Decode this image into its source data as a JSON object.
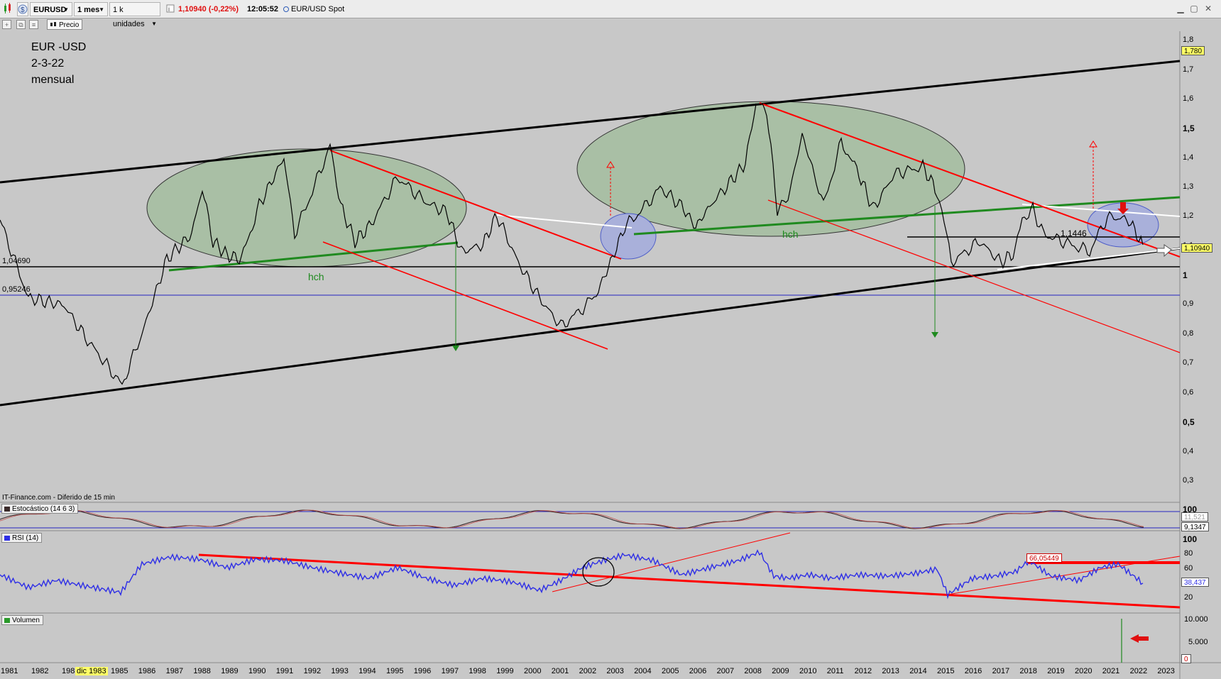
{
  "toolbar": {
    "symbol": "EURUSD",
    "timeframe": "1 mes",
    "units": "1 k unidades",
    "last_price": "1,10940 (-0,22%)",
    "time": "12:05:52",
    "instrument_name": "EUR/USD Spot"
  },
  "subbar": {
    "precio_label": "Precio"
  },
  "annotation": {
    "line1": "EUR -USD",
    "line2": "2-3-22",
    "line3": "mensual"
  },
  "price_panel": {
    "y_labels": [
      "1,8",
      "1,7",
      "1,6",
      "1,5",
      "1,4",
      "1,3",
      "1,2",
      "1,1",
      "1",
      "0,9",
      "0,8",
      "0,7",
      "0,6",
      "0,5",
      "0,4",
      "0,3"
    ],
    "current_price_box": "1,10940",
    "top_price_box": "1,780",
    "level_left_1": "1,04690",
    "level_left_2": "0,95246",
    "level_mid": "1,1446",
    "hch_labels": [
      "hch",
      "hch"
    ],
    "source_note": "IT-Finance.com - Diferido de 15 min"
  },
  "stochastic": {
    "title": "Estocástico (14 6 3)",
    "y_top": "100",
    "value_box": "9,1347",
    "hidden_box": "11,521"
  },
  "rsi": {
    "title": "RSI (14)",
    "y_labels": [
      "100",
      "80",
      "60",
      "40",
      "20"
    ],
    "value_box": "38,437",
    "level_box": "66,05449"
  },
  "volume": {
    "title": "Volumen",
    "y_labels": [
      "10.000",
      "5.000",
      "0"
    ]
  },
  "x_axis": {
    "labels": [
      "1981",
      "1982",
      "1983",
      "dic 1983",
      "1985",
      "1986",
      "1987",
      "1988",
      "1989",
      "1990",
      "1991",
      "1992",
      "1993",
      "1994",
      "1995",
      "1996",
      "1997",
      "1998",
      "1999",
      "2000",
      "2001",
      "2002",
      "2003",
      "2004",
      "2005",
      "2006",
      "2007",
      "2008",
      "2009",
      "2010",
      "2011",
      "2012",
      "2013",
      "2014",
      "2015",
      "2016",
      "2017",
      "2018",
      "2019",
      "2020",
      "2021",
      "2022",
      "2023"
    ]
  },
  "colors": {
    "background": "#c8c8c8",
    "price_line": "#000000",
    "trend_red": "#ff0000",
    "neckline_green": "#1f8a1f",
    "rsi_line": "#2e2ee6",
    "channel": "#000000",
    "ellipse_fill": "#a9bfa5"
  }
}
